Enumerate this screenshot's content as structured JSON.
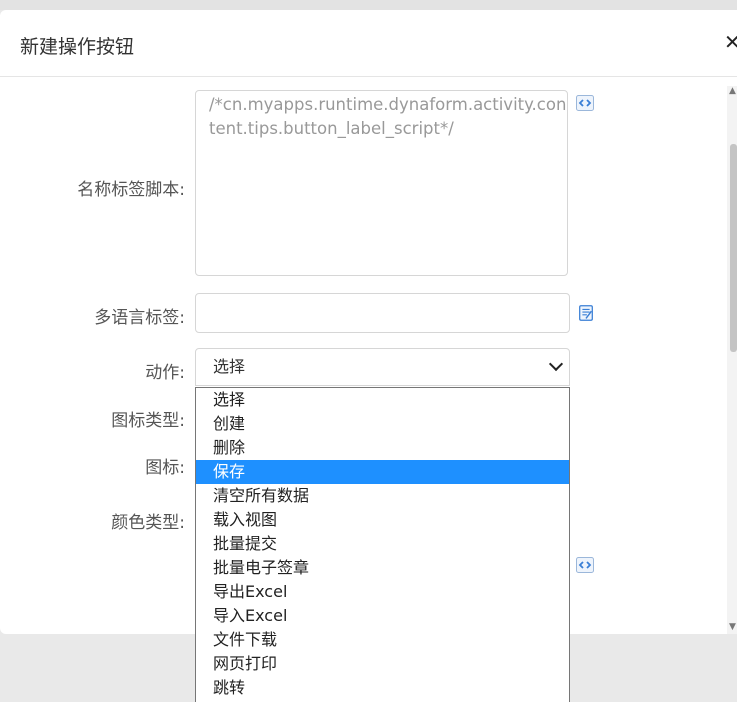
{
  "dialog": {
    "title": "新建操作按钮",
    "close_icon": "close-icon"
  },
  "form": {
    "label_script_label": "名称标签脚本:",
    "label_script_value": "/*cn.myapps.runtime.dynaform.activity.content.tips.button_label_script*/",
    "multilang_label": "多语言标签:",
    "multilang_value": "",
    "action_label": "动作:",
    "action_value": "选择",
    "icon_type_label": "图标类型:",
    "icon_label": "图标:",
    "color_type_label": "颜色类型:"
  },
  "dropdown": {
    "options": [
      "选择",
      "创建",
      "删除",
      "保存",
      "清空所有数据",
      "载入视图",
      "批量提交",
      "批量电子签章",
      "导出Excel",
      "导入Excel",
      "文件下载",
      "网页打印",
      "跳转"
    ],
    "highlighted": "保存"
  },
  "colors": {
    "highlight": "#1e90ff",
    "icon_blue": "#3a7fd5"
  }
}
